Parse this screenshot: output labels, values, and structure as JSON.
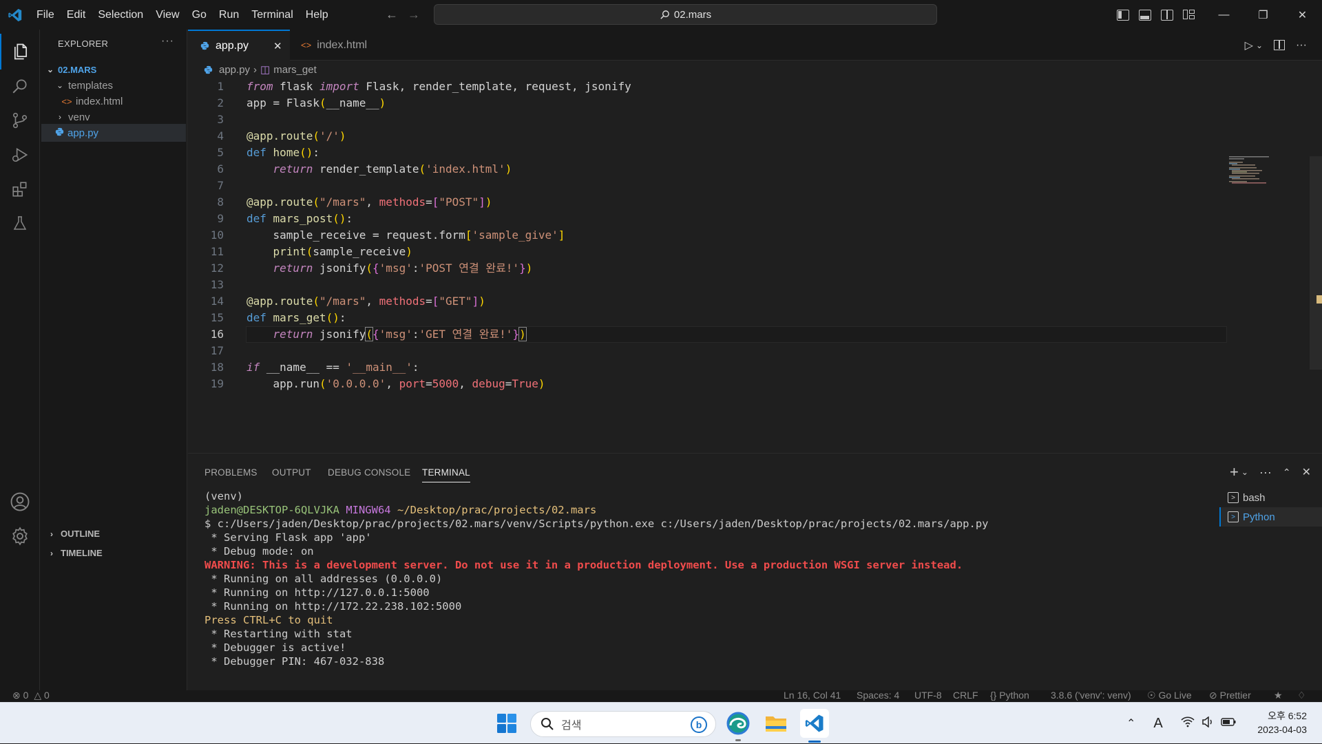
{
  "titlebar": {
    "menu": [
      "File",
      "Edit",
      "Selection",
      "View",
      "Go",
      "Run",
      "Terminal",
      "Help"
    ],
    "search": "02.mars"
  },
  "sidebar": {
    "title": "EXPLORER",
    "folder": "02.MARS",
    "items": [
      {
        "label": "templates"
      },
      {
        "label": "index.html"
      },
      {
        "label": "venv"
      },
      {
        "label": "app.py"
      }
    ],
    "outline": "OUTLINE",
    "timeline": "TIMELINE"
  },
  "tabs": [
    {
      "label": "app.py"
    },
    {
      "label": "index.html"
    }
  ],
  "breadcrumb": {
    "file": "app.py",
    "symbol": "mars_get"
  },
  "editor": {
    "current_line": 16,
    "line_numbers": [
      "1",
      "2",
      "3",
      "4",
      "5",
      "6",
      "7",
      "8",
      "9",
      "10",
      "11",
      "12",
      "13",
      "14",
      "15",
      "16",
      "17",
      "18",
      "19"
    ]
  },
  "panel": {
    "tabs": [
      "PROBLEMS",
      "OUTPUT",
      "DEBUG CONSOLE",
      "TERMINAL"
    ],
    "active_tab": "TERMINAL",
    "terminals": [
      {
        "label": "bash"
      },
      {
        "label": "Python"
      }
    ],
    "terminal_lines": {
      "venv": "(venv)",
      "user": "jaden@DESKTOP-6QLVJKA",
      "shell": "MINGW64",
      "cwd": "~/Desktop/prac/projects/02.mars",
      "cmd": "$ c:/Users/jaden/Desktop/prac/projects/02.mars/venv/Scripts/python.exe c:/Users/jaden/Desktop/prac/projects/02.mars/app.py",
      "l1": " * Serving Flask app 'app'",
      "l2": " * Debug mode: on",
      "warning": "WARNING: This is a development server. Do not use it in a production deployment. Use a production WSGI server instead.",
      "l3": " * Running on all addresses (0.0.0.0)",
      "l4": " * Running on http://127.0.0.1:5000",
      "l5": " * Running on http://172.22.238.102:5000",
      "quit": "Press CTRL+C to quit",
      "l6": " * Restarting with stat",
      "l7": " * Debugger is active!",
      "l8": " * Debugger PIN: 467-032-838"
    }
  },
  "statusbar": {
    "errors": "0",
    "warnings": "0",
    "position": "Ln 16, Col 41",
    "spaces": "Spaces: 4",
    "encoding": "UTF-8",
    "eol": "CRLF",
    "language": "Python",
    "interpreter": "3.8.6 ('venv': venv)",
    "golive": "Go Live",
    "prettier": "Prettier"
  },
  "taskbar": {
    "search_placeholder": "검색",
    "time": "오후 6:52",
    "date": "2023-04-03"
  },
  "colors": {
    "accent": "#0078d4",
    "editor_bg": "#1f1f1f",
    "chrome_bg": "#181818",
    "warning_red": "#f14c4c",
    "quit_yellow": "#e5c07b"
  }
}
